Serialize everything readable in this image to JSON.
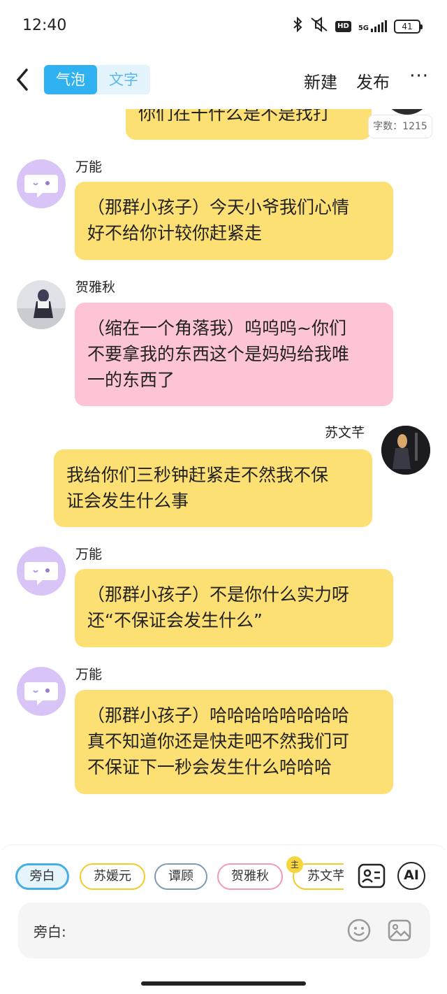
{
  "status_bar": {
    "time": "12:40",
    "network": "5G",
    "hd": "HD",
    "battery": "41",
    "icons": [
      "bluetooth-icon",
      "mute-icon",
      "hd-icon",
      "signal-icon",
      "battery-icon"
    ]
  },
  "navbar": {
    "back_icon": "chevron-left-icon",
    "mode_tabs": [
      "气泡",
      "文字"
    ],
    "new_label": "新建",
    "publish_label": "发布",
    "more_label": "···"
  },
  "word_count": "字数：1215",
  "messages": [
    {
      "sender": "",
      "text_lines": [
        "你们在干什么是不是找打"
      ],
      "side": "right"
    },
    {
      "sender": "万能",
      "text_lines": [
        "（那群小孩子）今天小爷我们心情",
        "好不给你计较你赶紧走"
      ],
      "side": "left"
    },
    {
      "sender": "贺雅秋",
      "text_lines": [
        "（缩在一个角落我）呜呜呜~你们",
        "不要拿我的东西这个是妈妈给我唯",
        "一的东西了"
      ],
      "side": "left"
    },
    {
      "sender": "苏文芊",
      "text_lines": [
        "我给你们三秒钟赶紧走不然我不保",
        "证会发生什么事"
      ],
      "side": "right"
    },
    {
      "sender": "万能",
      "text_lines": [
        "（那群小孩子）不是你什么实力呀",
        "还“不保证会发生什么”"
      ],
      "side": "left"
    },
    {
      "sender": "万能",
      "text_lines": [
        "（那群小孩子）哈哈哈哈哈哈哈哈",
        "真不知道你还是快走吧不然我们可",
        "不保证下一秒会发生什么哈哈哈"
      ],
      "side": "left"
    }
  ],
  "colors": {
    "accent": "#2fb1f2",
    "bubble_yellow": "#fde073",
    "bubble_pink": "#fcc4d4",
    "bot_avatar": "#d8c4f6"
  },
  "characters": {
    "chips": [
      {
        "label": "旁白",
        "border": "#45aee6",
        "selected": true
      },
      {
        "label": "苏媛元",
        "border": "#f1cc2c",
        "selected": false
      },
      {
        "label": "谭顾",
        "border": "#7f9bb5",
        "selected": false
      },
      {
        "label": "贺雅秋",
        "border": "#f09cb6",
        "selected": false
      },
      {
        "label": "苏文芊",
        "border": "#f1cc2c",
        "selected": false
      }
    ],
    "host_badge": "主"
  },
  "input": {
    "label": "旁白:",
    "icons": [
      "emoji-icon",
      "image-icon"
    ]
  },
  "tools": {
    "contact_icon": "contact-card-icon",
    "ai_label": "AI"
  }
}
